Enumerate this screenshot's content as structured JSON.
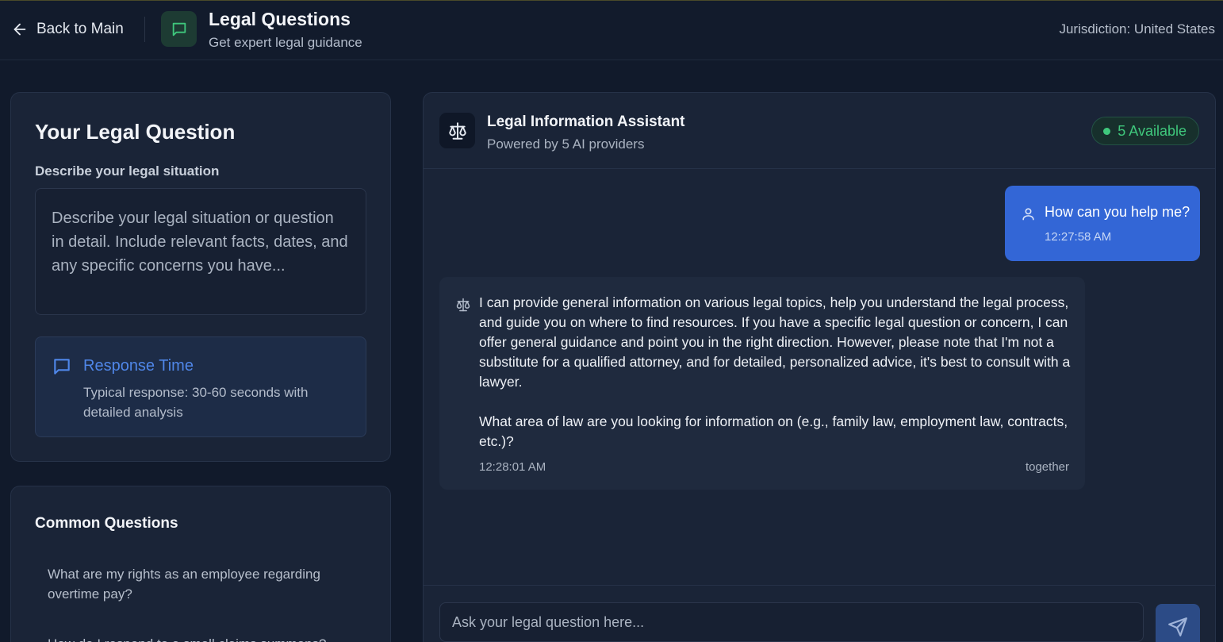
{
  "header": {
    "back_label": "Back to Main",
    "title": "Legal Questions",
    "subtitle": "Get expert legal guidance",
    "jurisdiction": "Jurisdiction: United States"
  },
  "question_panel": {
    "heading": "Your Legal Question",
    "field_label": "Describe your legal situation",
    "placeholder": "Describe your legal situation or question in detail. Include relevant facts, dates, and any specific concerns you have...",
    "value": "",
    "response_time": {
      "title": "Response Time",
      "description": "Typical response: 30-60 seconds with detailed analysis"
    }
  },
  "common_questions": {
    "heading": "Common Questions",
    "items": [
      "What are my rights as an employee regarding overtime pay?",
      "How do I respond to a small claims summons?"
    ]
  },
  "chat": {
    "title": "Legal Information Assistant",
    "subtitle": "Powered by 5 AI providers",
    "status": "5 Available",
    "messages": [
      {
        "role": "user",
        "text": "How can you help me?",
        "time": "12:27:58 AM"
      },
      {
        "role": "assistant",
        "paragraphs": [
          "I can provide general information on various legal topics, help you understand the legal process, and guide you on where to find resources. If you have a specific legal question or concern, I can offer general guidance and point you in the right direction. However, please note that I'm not a substitute for a qualified attorney, and for detailed, personalized advice, it's best to consult with a lawyer.",
          "What area of law are you looking for information on (e.g., family law, employment law, contracts, etc.)?"
        ],
        "time": "12:28:01 AM",
        "provider": "together"
      }
    ],
    "input_placeholder": "Ask your legal question here...",
    "input_value": ""
  },
  "colors": {
    "background": "#111a2b",
    "panel": "#1a2437",
    "accent_blue": "#3366d6",
    "status_green": "#3fc77c"
  },
  "icons": {
    "back": "arrow-left-icon",
    "app": "chat-bubble-icon",
    "assistant": "scales-icon",
    "user": "user-icon",
    "send": "send-icon"
  }
}
